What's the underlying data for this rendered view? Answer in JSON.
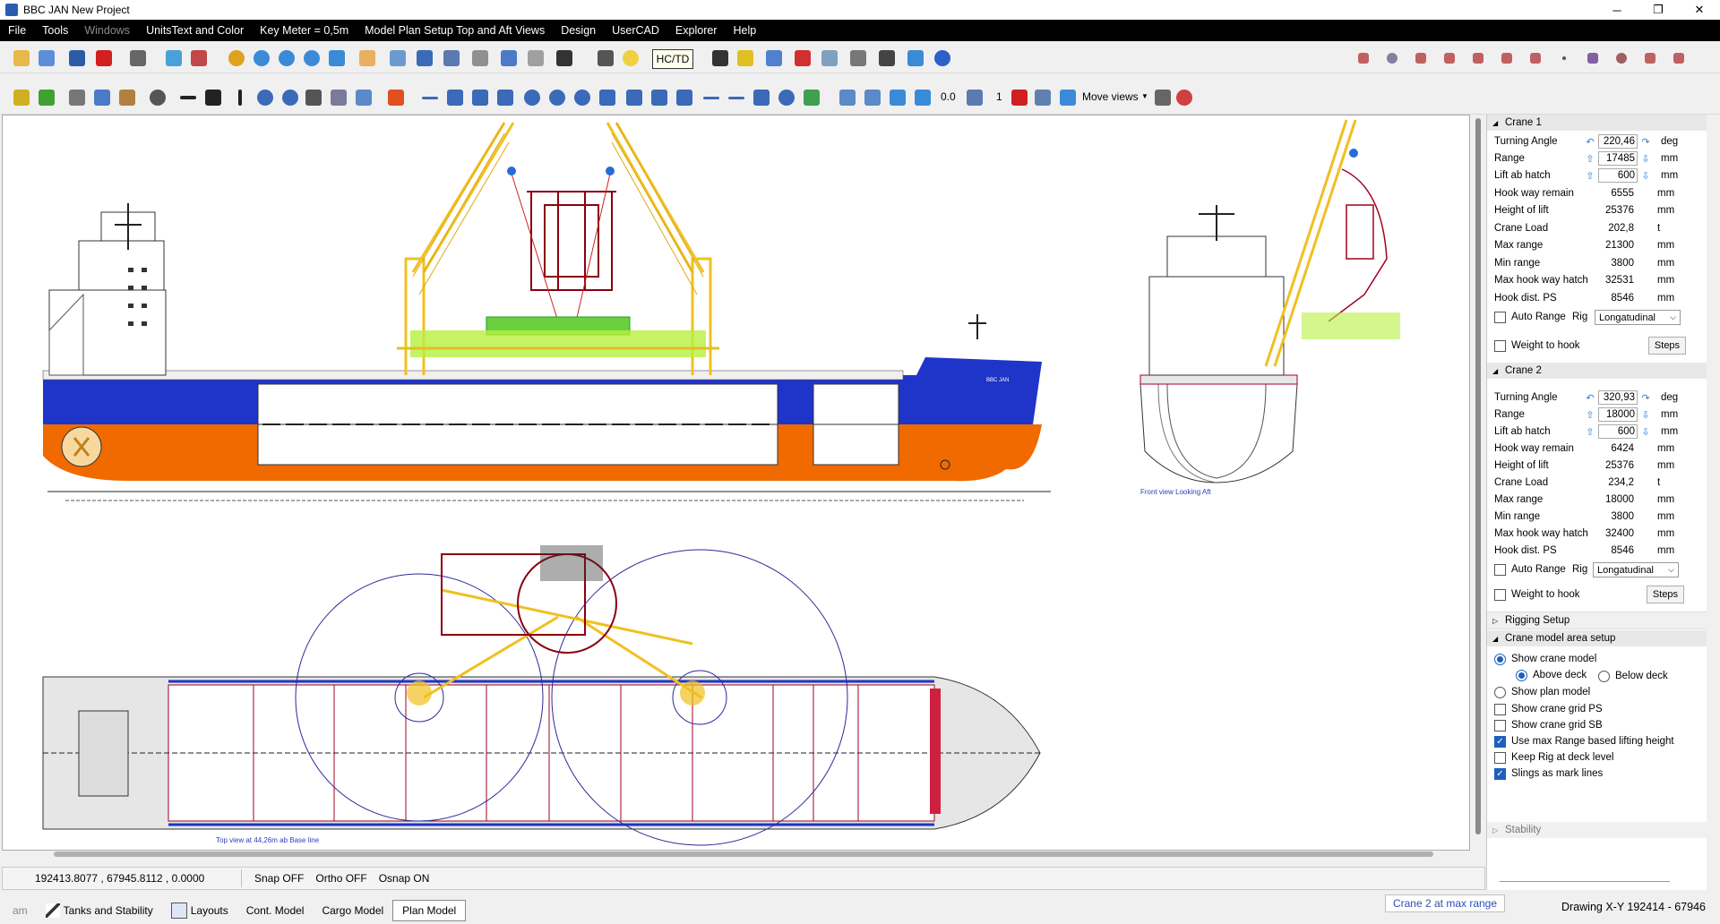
{
  "window": {
    "title": "BBC JAN New Project",
    "min": "─",
    "max": "❐",
    "close": "✕"
  },
  "menu": [
    "File",
    "Tools",
    "Windows",
    "UnitsText and Color",
    "Key Meter = 0,5m",
    "Model Plan Setup Top and Aft Views",
    "Design",
    "UserCAD",
    "Explorer",
    "Help"
  ],
  "toolbar": {
    "hctd": "HC/TD",
    "zero": "0.0",
    "one": "1",
    "move_views": "Move views"
  },
  "canvas": {
    "ship_name": "BBC JAN",
    "front_caption": "Front view  Looking Aft",
    "top_caption": "Top view at 44,26m  ab Base line"
  },
  "status": {
    "coords": "192413.8077 , 67945.8112 , 0.0000",
    "snap": "Snap OFF",
    "ortho": "Ortho OFF",
    "osnap": "Osnap ON"
  },
  "tabs": [
    {
      "label": "am"
    },
    {
      "label": "Tanks and Stability"
    },
    {
      "label": "Layouts"
    },
    {
      "label": "Cont. Model"
    },
    {
      "label": "Cargo Model"
    },
    {
      "label": "Plan Model"
    }
  ],
  "message": "Crane 2 at max range",
  "drawing_xy": "Drawing X-Y 192414 - 67946",
  "panel": {
    "crane1": {
      "header": "Crane 1",
      "rows": [
        {
          "label": "Turning Angle",
          "value": "220,46",
          "unit": "deg"
        },
        {
          "label": "Range",
          "value": "17485",
          "unit": "mm"
        },
        {
          "label": "Lift ab hatch",
          "value": "600",
          "unit": "mm"
        },
        {
          "label": "Hook way remain",
          "value": "6555",
          "unit": "mm"
        },
        {
          "label": "Height of lift",
          "value": "25376",
          "unit": "mm"
        },
        {
          "label": "Crane Load",
          "value": "202,8",
          "unit": "t"
        },
        {
          "label": "Max range",
          "value": "21300",
          "unit": "mm"
        },
        {
          "label": "Min range",
          "value": "3800",
          "unit": "mm"
        },
        {
          "label": "Max hook way hatch",
          "value": "32531",
          "unit": "mm"
        },
        {
          "label": "Hook dist. PS",
          "value": "8546",
          "unit": "mm"
        }
      ],
      "auto_range": "Auto Range",
      "rig_label": "Rig",
      "rig_value": "Longatudinal",
      "weight_to_hook": "Weight to hook",
      "steps": "Steps"
    },
    "crane2": {
      "header": "Crane 2",
      "rows": [
        {
          "label": "Turning Angle",
          "value": "320,93",
          "unit": "deg"
        },
        {
          "label": "Range",
          "value": "18000",
          "unit": "mm"
        },
        {
          "label": "Lift ab hatch",
          "value": "600",
          "unit": "mm"
        },
        {
          "label": "Hook way remain",
          "value": "6424",
          "unit": "mm"
        },
        {
          "label": "Height of lift",
          "value": "25376",
          "unit": "mm"
        },
        {
          "label": "Crane Load",
          "value": "234,2",
          "unit": "t"
        },
        {
          "label": "Max range",
          "value": "18000",
          "unit": "mm"
        },
        {
          "label": "Min range",
          "value": "3800",
          "unit": "mm"
        },
        {
          "label": "Max hook way hatch",
          "value": "32400",
          "unit": "mm"
        },
        {
          "label": "Hook dist. PS",
          "value": "8546",
          "unit": "mm"
        }
      ],
      "auto_range": "Auto Range",
      "rig_label": "Rig",
      "rig_value": "Longatudinal",
      "weight_to_hook": "Weight to hook",
      "steps": "Steps"
    },
    "rigging_setup": "Rigging Setup",
    "model_area": {
      "header": "Crane model area setup",
      "show_crane_model": "Show crane model",
      "above_deck": "Above deck",
      "below_deck": "Below deck",
      "show_plan_model": "Show plan model",
      "show_grid_ps": "Show crane grid PS",
      "show_grid_sb": "Show crane grid SB",
      "use_max_range": "Use max Range based lifting height",
      "keep_rig": "Keep Rig at deck level",
      "slings": "Slings as mark lines"
    },
    "stability": "Stability"
  },
  "colors": {
    "hull_blue": "#1f34c8",
    "hull_orange": "#f06a00",
    "crane_yellow": "#f0c020",
    "accent": "#1e5fbf"
  }
}
